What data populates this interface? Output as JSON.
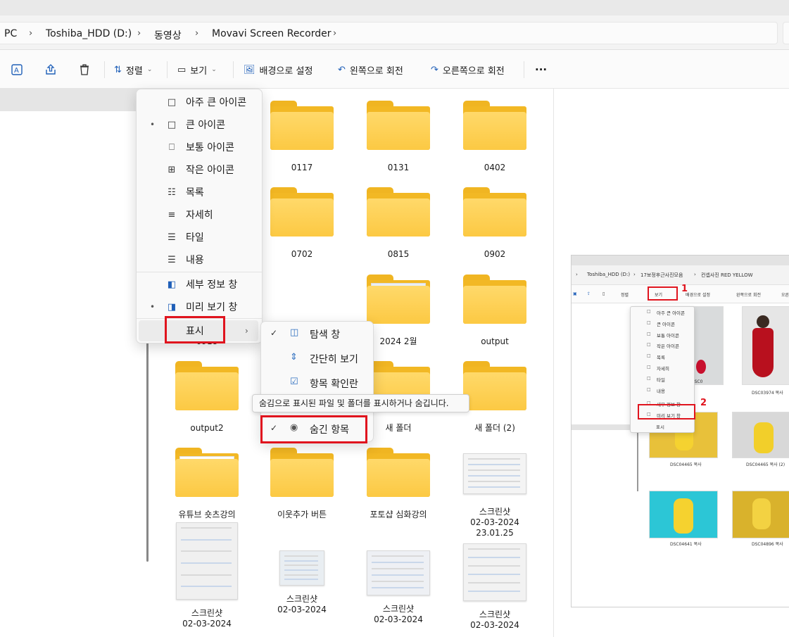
{
  "breadcrumb": {
    "items": [
      "PC",
      "Toshiba_HDD (D:)",
      "동영상",
      "Movavi Screen Recorder"
    ]
  },
  "toolbar": {
    "sort_label": "정렬",
    "view_label": "보기",
    "wallpaper_label": "배경으로 설정",
    "rotate_left_label": "왼쪽으로 회전",
    "rotate_right_label": "오른쪽으로 회전",
    "more_label": "···"
  },
  "view_menu": {
    "items": [
      {
        "label": "아주 큰 아이콘",
        "icon": "□",
        "selected": false
      },
      {
        "label": "큰 아이콘",
        "icon": "□",
        "selected": true
      },
      {
        "label": "보통 아이콘",
        "icon": "⎕",
        "selected": false
      },
      {
        "label": "작은 아이콘",
        "icon": "⊞",
        "selected": false
      },
      {
        "label": "목록",
        "icon": "☷",
        "selected": false
      },
      {
        "label": "자세히",
        "icon": "≡",
        "selected": false
      },
      {
        "label": "타일",
        "icon": "☰",
        "selected": false
      },
      {
        "label": "내용",
        "icon": "☰",
        "selected": false
      },
      {
        "label": "세부 정보 창",
        "icon": "◧",
        "selected": false
      },
      {
        "label": "미리 보기 창",
        "icon": "◨",
        "selected": true
      },
      {
        "label": "표시",
        "icon": "",
        "selected": false
      }
    ],
    "selected_dot": "•",
    "arrow": "›"
  },
  "show_submenu": {
    "items": [
      {
        "label": "탐색 창",
        "icon": "◫",
        "checked": true
      },
      {
        "label": "간단히 보기",
        "icon": "⇕",
        "checked": false
      },
      {
        "label": "항목 확인란",
        "icon": "☑",
        "checked": false
      },
      {
        "label": "숨긴 항목",
        "icon": "◉",
        "checked": true
      }
    ],
    "check": "✓"
  },
  "tooltip": "숨김으로 표시된 파일 및 폴더를 표시하거나 숨깁니다.",
  "files": [
    {
      "name": "0117",
      "type": "folder"
    },
    {
      "name": "0131",
      "type": "folder"
    },
    {
      "name": "0402",
      "type": "folder"
    },
    {
      "name": "0702",
      "type": "folder"
    },
    {
      "name": "0815",
      "type": "folder"
    },
    {
      "name": "0902",
      "type": "folder"
    },
    {
      "name": "0918",
      "type": "folder"
    },
    {
      "name": "2024 2월",
      "type": "folder"
    },
    {
      "name": "output",
      "type": "folder"
    },
    {
      "name": "output2",
      "type": "folder"
    },
    {
      "name": "새 폴더",
      "type": "folder"
    },
    {
      "name": "새 폴더 (2)",
      "type": "folder"
    },
    {
      "name": "유튜브 숏츠강의",
      "type": "folder"
    },
    {
      "name": "이웃추가 버튼",
      "type": "folder"
    },
    {
      "name": "포토샵 심화강의",
      "type": "folder"
    },
    {
      "name": "스크린샷",
      "date": "02-03-2024",
      "time": "23.01.25",
      "type": "image"
    },
    {
      "name": "스크린샷",
      "date": "02-03-2024",
      "type": "image"
    },
    {
      "name": "스크린샷",
      "date": "02-03-2024",
      "type": "image"
    },
    {
      "name": "스크린샷",
      "date": "02-03-2024",
      "type": "image"
    },
    {
      "name": "스크린샷",
      "date": "02-03-2024",
      "type": "image"
    }
  ],
  "preview": {
    "breadcrumb": [
      "Toshiba_HDD (D:)",
      "17보정후근사진모음",
      "컨셉사진 RED YELLOW"
    ],
    "toolbar": [
      "정렬",
      "보기",
      "배경으로 설정",
      "왼쪽으로 회전",
      "오른쪽으로 회전"
    ],
    "menu_items": [
      "아주 큰 아이콘",
      "큰 아이콘",
      "보통 아이콘",
      "작은 아이콘",
      "목록",
      "자세히",
      "타일",
      "내용",
      "세부 정보 창",
      "미리 보기 창",
      "표시"
    ],
    "captions": [
      "DSC0",
      "DSC03974 복사",
      "DSC04465 복사",
      "DSC04465 복사 (2)",
      "DSC04641 복사",
      "DSC04896 복사"
    ],
    "step1": "1",
    "step2": "2"
  },
  "colors": {
    "highlight_red": "#e0141e",
    "folder_yellow": "#fcc943"
  }
}
